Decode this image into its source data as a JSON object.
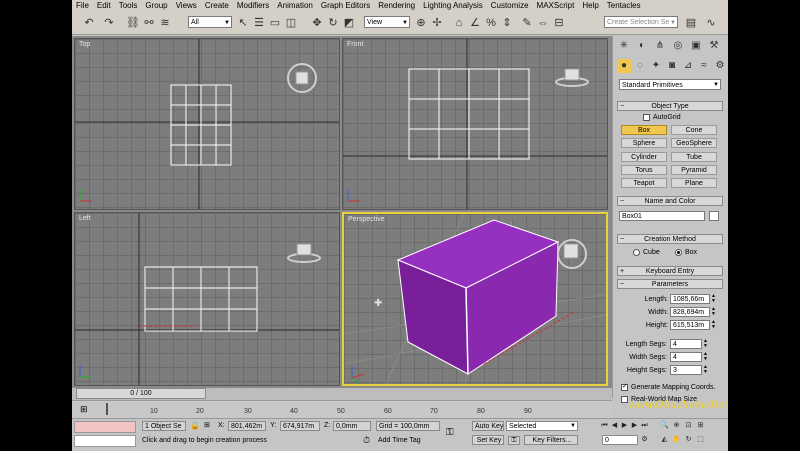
{
  "menu": [
    "File",
    "Edit",
    "Tools",
    "Group",
    "Views",
    "Create",
    "Modifiers",
    "Animation",
    "Graph Editors",
    "Rendering",
    "Lighting Analysis",
    "Customize",
    "MAXScript",
    "Help",
    "Tentacles"
  ],
  "toolbar": {
    "filter_value": "All",
    "refcoord_value": "View",
    "named_selection_placeholder": "Create Selection Se"
  },
  "viewports": {
    "top": "Top",
    "front": "Front",
    "left": "Left",
    "perspective": "Perspective"
  },
  "command_panel": {
    "category_dropdown": "Standard Primitives",
    "object_type": {
      "title": "Object Type",
      "autogrid": "AutoGrid",
      "buttons": [
        "Box",
        "Cone",
        "Sphere",
        "GeoSphere",
        "Cylinder",
        "Tube",
        "Torus",
        "Pyramid",
        "Teapot",
        "Plane"
      ],
      "active": "Box"
    },
    "name_color": {
      "title": "Name and Color",
      "name": "Box01",
      "swatch_color": "#ffffff"
    },
    "creation_method": {
      "title": "Creation Method",
      "cube": "Cube",
      "box": "Box",
      "selected": "Box"
    },
    "keyboard_entry": {
      "title": "Keyboard Entry"
    },
    "parameters": {
      "title": "Parameters",
      "length_label": "Length:",
      "length": "1085,66m",
      "width_label": "Width:",
      "width": "828,694m",
      "height_label": "Height:",
      "height": "615,513m",
      "length_segs_label": "Length Segs:",
      "length_segs": "4",
      "width_segs_label": "Width Segs:",
      "width_segs": "4",
      "height_segs_label": "Height Segs:",
      "height_segs": "3",
      "gen_mapping": "Generate Mapping Coords.",
      "real_world": "Real-World Map Size"
    }
  },
  "timeline": {
    "slider": "0 / 100",
    "ticks": [
      "10",
      "20",
      "30",
      "40",
      "50",
      "60",
      "70",
      "80",
      "90"
    ]
  },
  "status": {
    "selection": "1 Object Se",
    "x_label": "X:",
    "x_value": "801,462m",
    "y_label": "Y:",
    "y_value": "674,917m",
    "z_label": "Z:",
    "z_value": "0,0mm",
    "grid": "Grid = 100,0mm",
    "prompt": "Click and drag to begin creation process",
    "add_time_tag": "Add Time Tag",
    "auto_key": "Auto Key",
    "auto_key_mode": "Selected",
    "set_key": "Set Key",
    "key_filters": "Key Filters...",
    "frame": "0"
  },
  "watermark": "www.ObuchenieDoma.ru",
  "colors": {
    "box_purple": "#7a1f9a",
    "active_viewport": "#e6d23a",
    "active_button": "#f0c850"
  }
}
